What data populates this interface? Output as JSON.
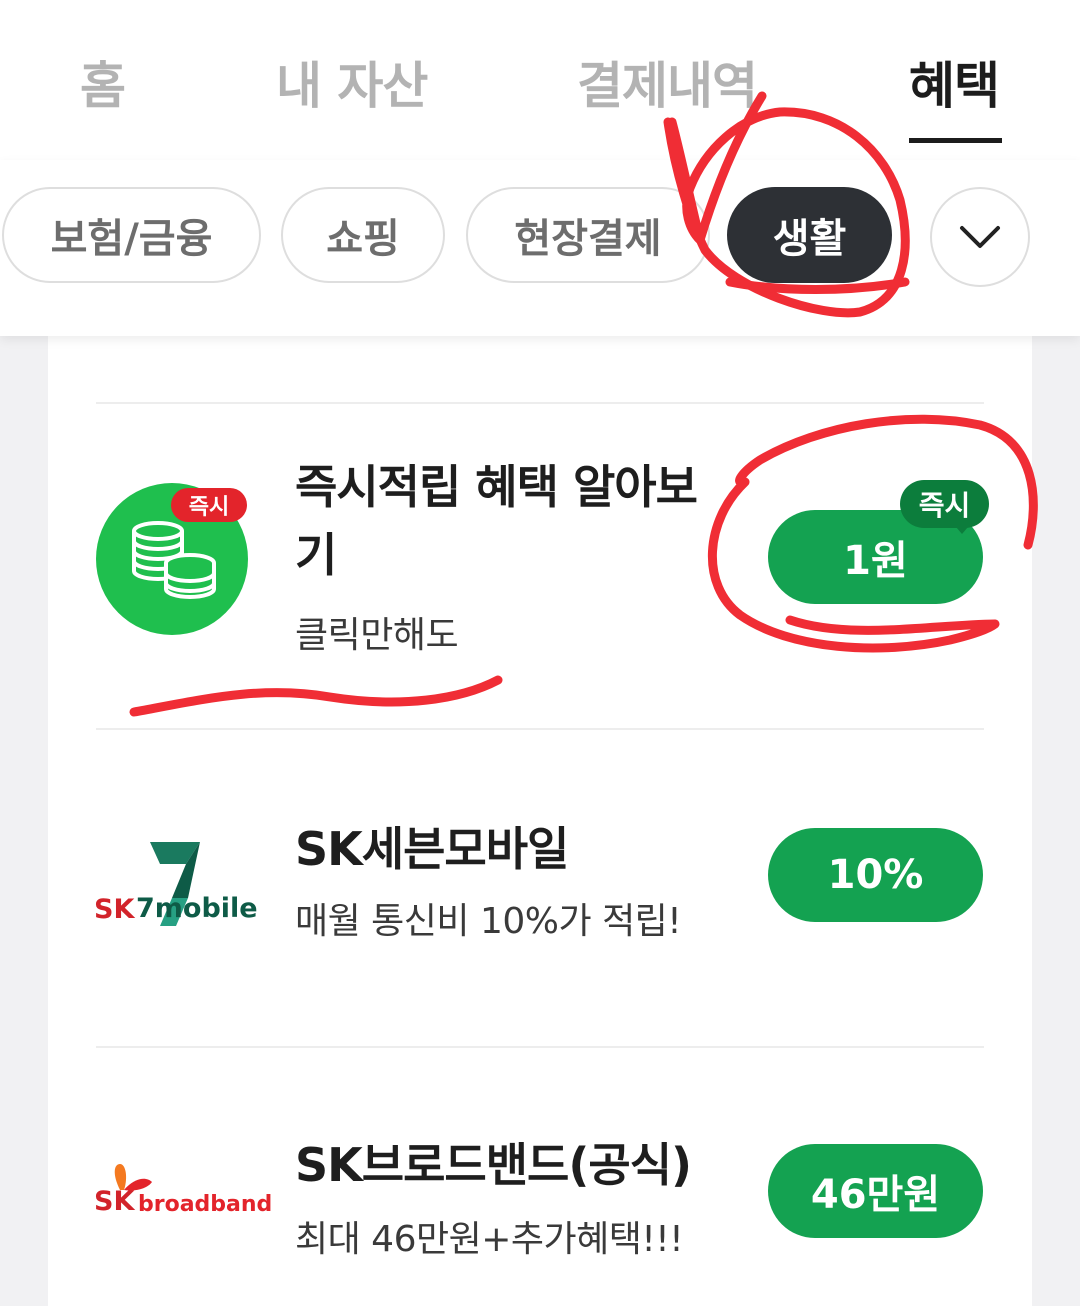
{
  "top_tabs": {
    "home": "홈",
    "assets": "내 자산",
    "payments": "결제내역",
    "benefits": "혜택"
  },
  "filter_chips": {
    "insurance_finance": "보험/금융",
    "shopping": "쇼핑",
    "onsite_payment": "현장결제",
    "living": "생활"
  },
  "benefit_items": [
    {
      "title_line1": "즉시적립 혜택 알아보",
      "title_line2": "기",
      "subtitle": "클릭만해도",
      "badge": "즉시",
      "reward": "1원",
      "reward_tag": "즉시"
    },
    {
      "title": "SK세븐모바일",
      "subtitle": "매월 통신비 10%가 적립!",
      "logo_text": "SK",
      "logo_text2": "7mobile",
      "reward": "10%"
    },
    {
      "title": "SK브로드밴드(공식)",
      "subtitle": "최대 46만원+추가혜택!!!",
      "logo_text": "SK",
      "logo_text2": "broadband",
      "reward": "46만원"
    }
  ],
  "colors": {
    "accent_green": "#14a251",
    "dark_green": "#0c7d3c",
    "active_chip": "#2d3035",
    "annotation_red": "#f02d35"
  },
  "icons": {
    "expand": "chevron-down-icon",
    "coins": "coins-icon"
  }
}
